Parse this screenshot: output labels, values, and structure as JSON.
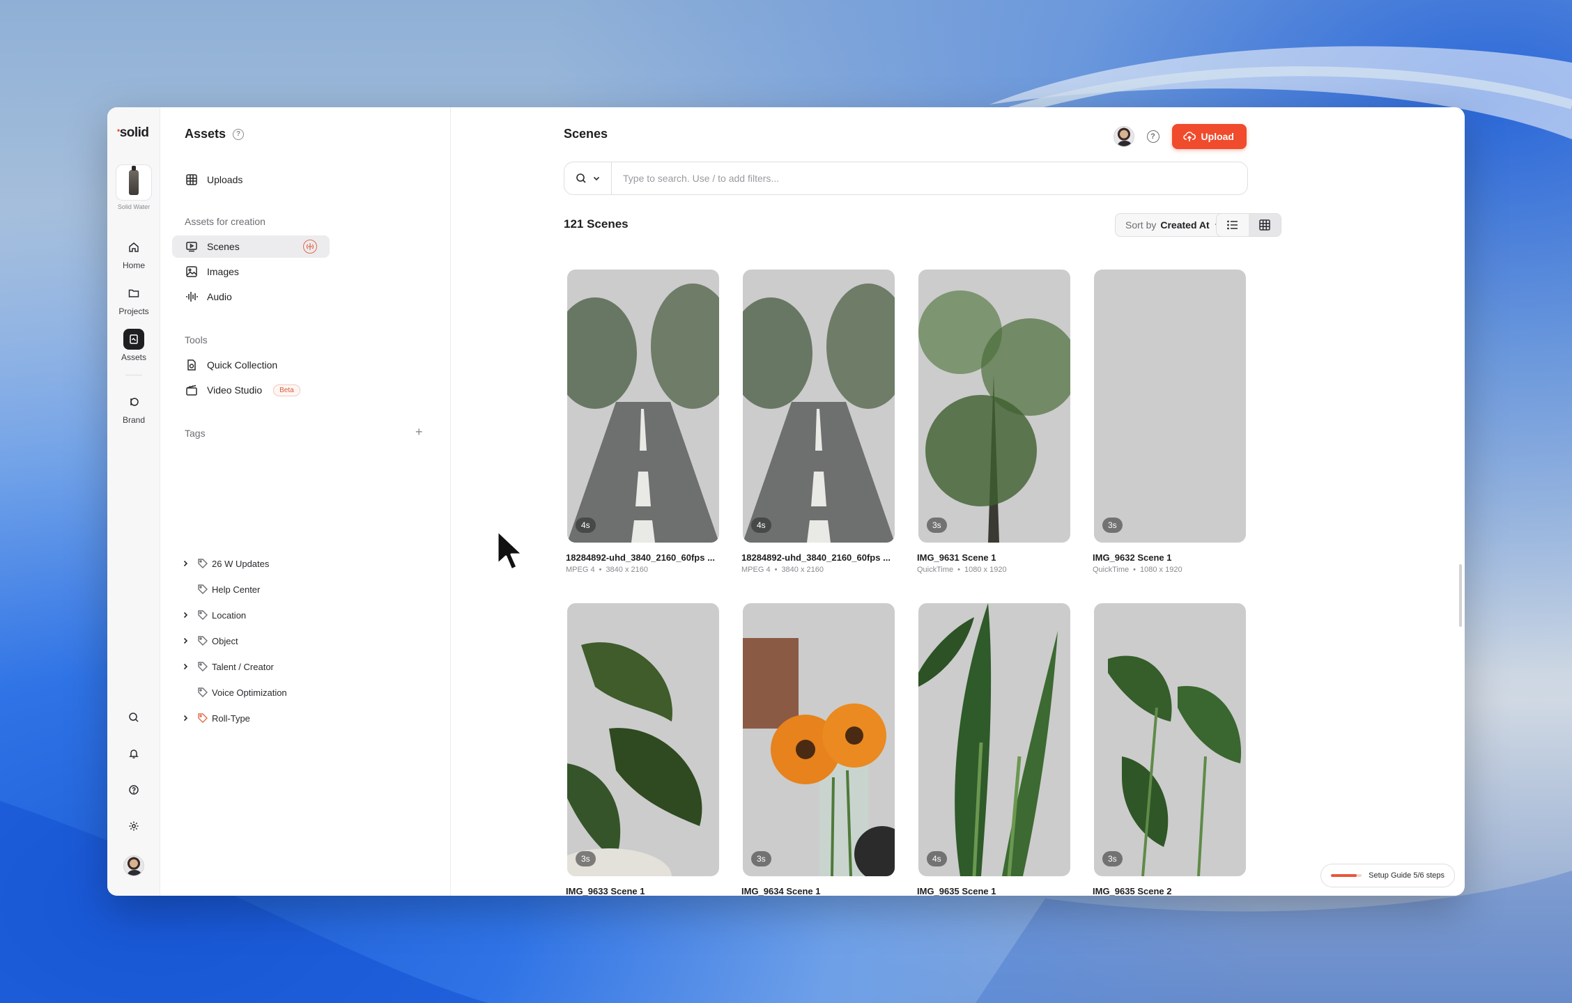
{
  "app": {
    "logo": "solid"
  },
  "workspace": {
    "name": "Solid Water"
  },
  "rail": {
    "items": [
      {
        "label": "Home",
        "icon": "home-icon"
      },
      {
        "label": "Projects",
        "icon": "folder-icon"
      },
      {
        "label": "Assets",
        "icon": "assets-icon",
        "active": true
      },
      {
        "label": "Brand",
        "icon": "brand-icon"
      }
    ]
  },
  "nav": {
    "title": "Assets",
    "uploads": "Uploads",
    "section_creation": "Assets for creation",
    "creation_items": [
      "Scenes",
      "Images",
      "Audio"
    ],
    "section_tools": "Tools",
    "tools": {
      "quick_collection": "Quick Collection",
      "video_studio": "Video Studio",
      "beta": "Beta"
    },
    "section_tags": "Tags",
    "tags": [
      {
        "label": "26 W Updates",
        "expandable": true
      },
      {
        "label": "Help Center",
        "expandable": false
      },
      {
        "label": "Location",
        "expandable": true
      },
      {
        "label": "Object",
        "expandable": true
      },
      {
        "label": "Talent / Creator",
        "expandable": true
      },
      {
        "label": "Voice Optimization",
        "expandable": false
      },
      {
        "label": "Roll-Type",
        "expandable": true,
        "color": "#e36a4a"
      }
    ]
  },
  "main": {
    "title": "Scenes",
    "upload_label": "Upload",
    "search_placeholder": "Type to search. Use / to add filters...",
    "count": "121 Scenes",
    "sort_prefix": "Sort by",
    "sort_value": "Created At",
    "scenes": [
      {
        "title": "18284892-uhd_3840_2160_60fps ...",
        "format": "MPEG 4",
        "res": "3840 x 2160",
        "dur": "4s",
        "bg": "road"
      },
      {
        "title": "18284892-uhd_3840_2160_60fps ...",
        "format": "MPEG 4",
        "res": "3840 x 2160",
        "dur": "4s",
        "bg": "road"
      },
      {
        "title": "IMG_9631 Scene 1",
        "format": "QuickTime",
        "res": "1080 x 1920",
        "dur": "3s",
        "bg": "tree"
      },
      {
        "title": "IMG_9632 Scene 1",
        "format": "QuickTime",
        "res": "1080 x 1920",
        "dur": "3s",
        "bg": "tradescantia"
      },
      {
        "title": "IMG_9633 Scene 1",
        "format": "",
        "res": "",
        "dur": "3s",
        "bg": "monstera"
      },
      {
        "title": "IMG_9634 Scene 1",
        "format": "",
        "res": "",
        "dur": "3s",
        "bg": "gerbera"
      },
      {
        "title": "IMG_9635 Scene 1",
        "format": "",
        "res": "",
        "dur": "4s",
        "bg": "strelitzia"
      },
      {
        "title": "IMG_9635 Scene 2",
        "format": "",
        "res": "",
        "dur": "3s",
        "bg": "pothos"
      }
    ]
  },
  "setup_guide": {
    "label": "Setup Guide 5/6 steps",
    "progress": 0.83
  },
  "colors": {
    "accent": "#ef4b2c"
  }
}
